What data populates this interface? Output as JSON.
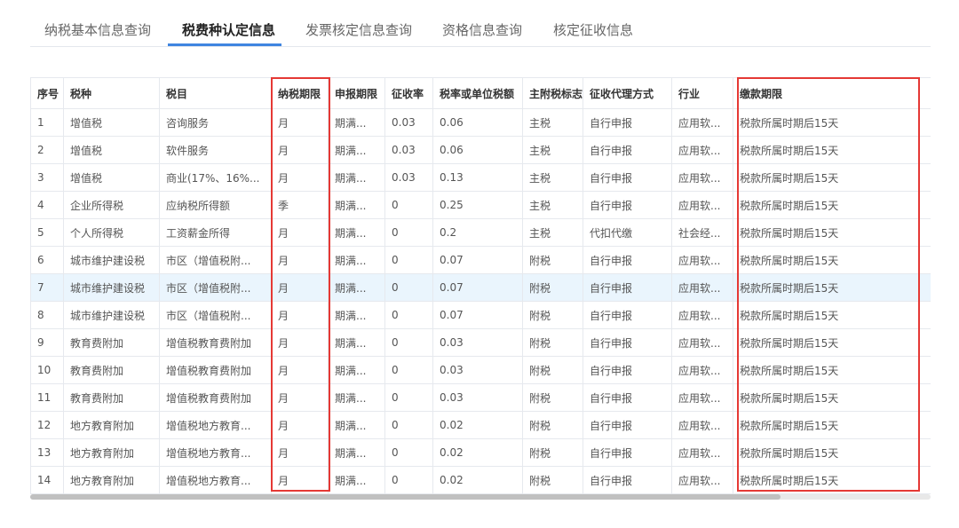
{
  "tabs": [
    {
      "label": "纳税基本信息查询"
    },
    {
      "label": "税费种认定信息"
    },
    {
      "label": "发票核定信息查询"
    },
    {
      "label": "资格信息查询"
    },
    {
      "label": "核定征收信息"
    }
  ],
  "active_tab_index": 1,
  "colors": {
    "accent": "#3f85e0",
    "highlight_row": "#eaf5fd",
    "annotation": "#e53935"
  },
  "table": {
    "columns": [
      "序号",
      "税种",
      "税目",
      "纳税期限",
      "申报期限",
      "征收率",
      "税率或单位税额",
      "主附税标志",
      "征收代理方式",
      "行业",
      "缴款期限"
    ],
    "highlighted_row_index": 6,
    "rows": [
      [
        "1",
        "增值税",
        "咨询服务",
        "月",
        "期满...",
        "0.03",
        "0.06",
        "主税",
        "自行申报",
        "应用软...",
        "税款所属时期后15天"
      ],
      [
        "2",
        "增值税",
        "软件服务",
        "月",
        "期满...",
        "0.03",
        "0.06",
        "主税",
        "自行申报",
        "应用软...",
        "税款所属时期后15天"
      ],
      [
        "3",
        "增值税",
        "商业(17%、16%...",
        "月",
        "期满...",
        "0.03",
        "0.13",
        "主税",
        "自行申报",
        "应用软...",
        "税款所属时期后15天"
      ],
      [
        "4",
        "企业所得税",
        "应纳税所得额",
        "季",
        "期满...",
        "0",
        "0.25",
        "主税",
        "自行申报",
        "应用软...",
        "税款所属时期后15天"
      ],
      [
        "5",
        "个人所得税",
        "工资薪金所得",
        "月",
        "期满...",
        "0",
        "0.2",
        "主税",
        "代扣代缴",
        "社会经...",
        "税款所属时期后15天"
      ],
      [
        "6",
        "城市维护建设税",
        "市区（增值税附...",
        "月",
        "期满...",
        "0",
        "0.07",
        "附税",
        "自行申报",
        "应用软...",
        "税款所属时期后15天"
      ],
      [
        "7",
        "城市维护建设税",
        "市区（增值税附...",
        "月",
        "期满...",
        "0",
        "0.07",
        "附税",
        "自行申报",
        "应用软...",
        "税款所属时期后15天"
      ],
      [
        "8",
        "城市维护建设税",
        "市区（增值税附...",
        "月",
        "期满...",
        "0",
        "0.07",
        "附税",
        "自行申报",
        "应用软...",
        "税款所属时期后15天"
      ],
      [
        "9",
        "教育费附加",
        "增值税教育费附加",
        "月",
        "期满...",
        "0",
        "0.03",
        "附税",
        "自行申报",
        "应用软...",
        "税款所属时期后15天"
      ],
      [
        "10",
        "教育费附加",
        "增值税教育费附加",
        "月",
        "期满...",
        "0",
        "0.03",
        "附税",
        "自行申报",
        "应用软...",
        "税款所属时期后15天"
      ],
      [
        "11",
        "教育费附加",
        "增值税教育费附加",
        "月",
        "期满...",
        "0",
        "0.03",
        "附税",
        "自行申报",
        "应用软...",
        "税款所属时期后15天"
      ],
      [
        "12",
        "地方教育附加",
        "增值税地方教育...",
        "月",
        "期满...",
        "0",
        "0.02",
        "附税",
        "自行申报",
        "应用软...",
        "税款所属时期后15天"
      ],
      [
        "13",
        "地方教育附加",
        "增值税地方教育...",
        "月",
        "期满...",
        "0",
        "0.02",
        "附税",
        "自行申报",
        "应用软...",
        "税款所属时期后15天"
      ],
      [
        "14",
        "地方教育附加",
        "增值税地方教育...",
        "月",
        "期满...",
        "0",
        "0.02",
        "附税",
        "自行申报",
        "应用软...",
        "税款所属时期后15天"
      ]
    ]
  }
}
